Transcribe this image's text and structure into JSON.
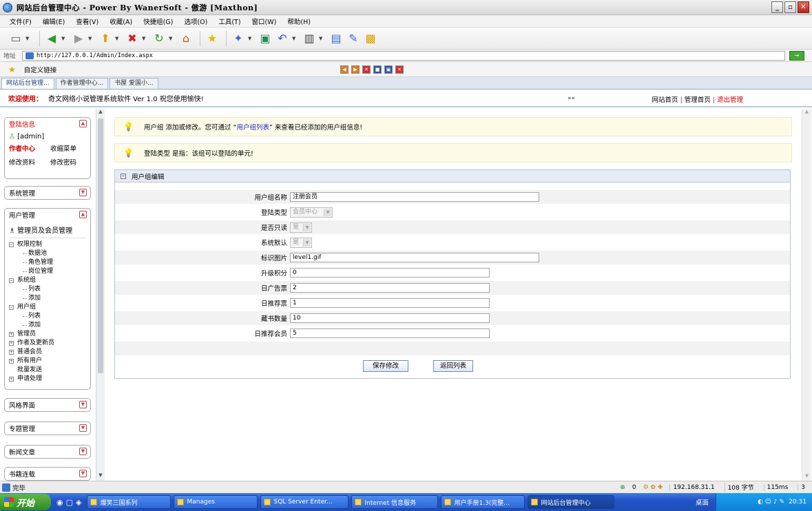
{
  "window": {
    "title": "网站后台管理中心 - Power By WanerSoft - 傲游 [Maxthon]",
    "buttons": {
      "min": "_",
      "max": "▫",
      "close": "✕"
    }
  },
  "menu": [
    "文件(F)",
    "编辑(E)",
    "查看(V)",
    "收藏(A)",
    "快捷组(G)",
    "选项(O)",
    "工具(T)",
    "窗口(W)",
    "帮助(H)"
  ],
  "address": {
    "label": "地址",
    "url": "http://127.0.0.1/Admin/Index.aspx",
    "go": "→"
  },
  "links_bar": {
    "label": "自定义链接"
  },
  "tabs": [
    {
      "label": "网站后台管理..."
    },
    {
      "label": "作者管理中心..."
    },
    {
      "label": "书屋 爱国小..."
    }
  ],
  "welcome": {
    "label": "欢迎使用：",
    "text": "奇文网络小说管理系统软件  Ver 1.0   祝您使用愉快!",
    "collapse": "««",
    "links": {
      "home": "网站首页",
      "admin_home": "管理首页",
      "logout": "退出管理"
    }
  },
  "sidebar": {
    "login_panel": {
      "title": "登陆信息",
      "user": "[admin]",
      "links": [
        "作者中心",
        "收缩菜单",
        "修改资料",
        "修改密码"
      ]
    },
    "system_panel": {
      "title": "系统管理"
    },
    "user_panel": {
      "title": "用户管理",
      "subtitle": "管理员及会员管理",
      "tree": {
        "perm": "权限控制",
        "perm_children": [
          "数据池",
          "角色管理",
          "岗位管理"
        ],
        "sysgroup": "系统组",
        "sysgroup_children": [
          "列表",
          "添加"
        ],
        "usergroup": "用户组",
        "usergroup_children": [
          "列表",
          "添加"
        ],
        "admins": "管理员",
        "authors": "作者及更新员",
        "members": "普通会员",
        "allusers": "所有用户",
        "bulk": "批量发送",
        "apply": "申请处理"
      }
    },
    "style_panel": {
      "title": "风格界面"
    },
    "topic_panel": {
      "title": "专题管理"
    },
    "news_panel": {
      "title": "新闻文章"
    },
    "book_panel": {
      "title": "书籍连载"
    }
  },
  "tips": {
    "tip1_pre": "用户组 添加或修改。您可通过 “",
    "tip1_link": "用户组列表",
    "tip1_post": "” 来查看已经添加的用户组信息!",
    "tip2": "登陆类型 是指：该组可以登陆的单元!"
  },
  "form": {
    "title": "用户组编辑",
    "fields": {
      "name_label": "用户组名称",
      "name_value": "注册会员",
      "login_type_label": "登陆类型",
      "login_type_value": "会员中心",
      "readonly_label": "是否只读",
      "readonly_value": "是",
      "default_label": "系统默认",
      "default_value": "是",
      "image_label": "标识图片",
      "image_value": "level1.gif",
      "upgrade_label": "升级积分",
      "upgrade_value": "0",
      "daily_ads_label": "日广告票",
      "daily_ads_value": "2",
      "daily_rec_label": "日推荐票",
      "daily_rec_value": "1",
      "shelf_label": "藏书数量",
      "shelf_value": "10",
      "daily_member_label": "日推荐会员",
      "daily_member_value": "5"
    },
    "save": "保存修改",
    "back": "返回列表"
  },
  "status": {
    "text": "完毕",
    "count": "0",
    "ip": "192.168.31.1",
    "bytes": "108 字节",
    "ms": "115ms",
    "num": "3"
  },
  "taskbar": {
    "start": "开始",
    "tasks": [
      "爆笑三国系列",
      "Manages",
      "SQL Server Enter...",
      "Internet 信息服务",
      "用户手册1.3(完整...",
      "网站后台管理中心"
    ],
    "desktop": "桌面",
    "clock": "20:31"
  }
}
